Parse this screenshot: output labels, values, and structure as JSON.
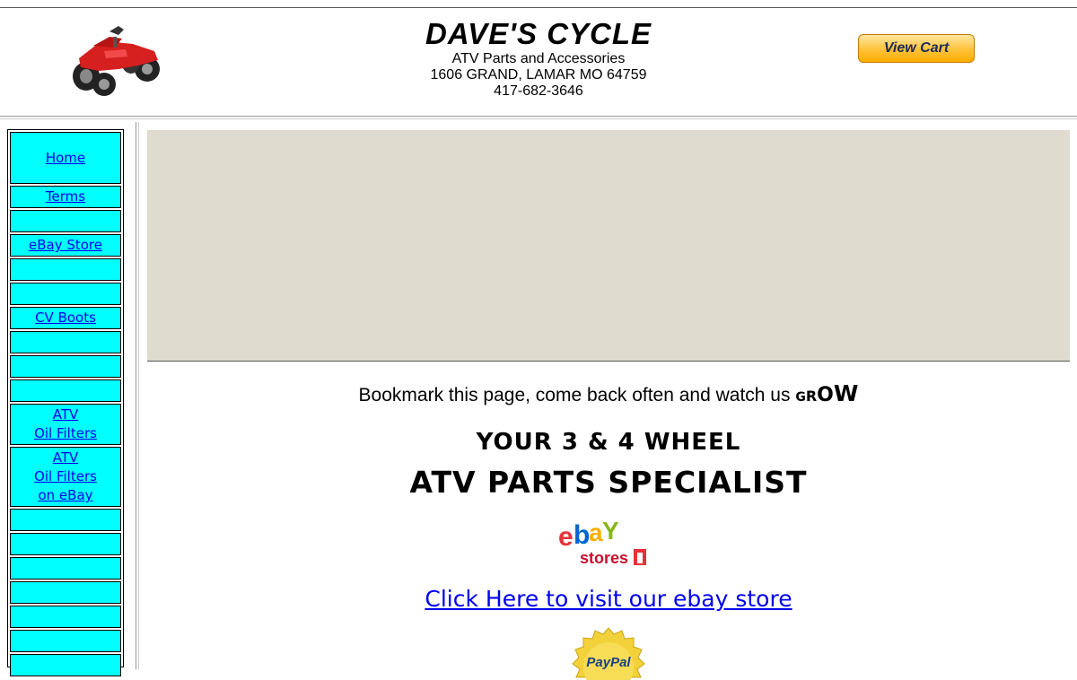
{
  "header": {
    "title": "DAVE'S CYCLE",
    "subtitle": "ATV Parts and Accessories",
    "address": "1606 GRAND, LAMAR MO 64759",
    "phone": "417-682-3646",
    "view_cart_label": "View Cart"
  },
  "sidebar": {
    "items": [
      {
        "lines": [
          "Home"
        ]
      },
      {
        "lines": [
          "Terms"
        ]
      },
      {
        "lines": []
      },
      {
        "lines": [
          "eBay Store"
        ]
      },
      {
        "lines": []
      },
      {
        "lines": []
      },
      {
        "lines": [
          "CV Boots"
        ]
      },
      {
        "lines": []
      },
      {
        "lines": []
      },
      {
        "lines": []
      },
      {
        "lines": [
          "ATV",
          "Oil Filters"
        ]
      },
      {
        "lines": [
          "ATV",
          "Oil Filters",
          "on eBay"
        ]
      },
      {
        "lines": []
      },
      {
        "lines": []
      },
      {
        "lines": []
      },
      {
        "lines": []
      },
      {
        "lines": []
      },
      {
        "lines": []
      },
      {
        "lines": []
      }
    ]
  },
  "main": {
    "bookmark_text": "Bookmark this page, come back often and watch us",
    "grow_letters": [
      "G",
      "R",
      "O",
      "W"
    ],
    "headline_1": "YOUR 3 & 4 WHEEL",
    "headline_2": "ATV PARTS SPECIALIST",
    "ebay_logo": {
      "letters": [
        "e",
        "b",
        "a",
        "Y"
      ],
      "stores_text": "stores"
    },
    "ebay_link_text": "Click Here to visit our ebay store",
    "paypal_seal_text": "PayPal"
  },
  "colors": {
    "nav_cell": "#00ffff",
    "banner": "#dfdbcf",
    "link": "#0000ee",
    "ebay_red": "#e53238",
    "ebay_blue": "#0064d2",
    "ebay_yellow": "#f5af02",
    "ebay_green": "#86b817"
  },
  "icons": {
    "header_logo": "red-quad-atv-icon",
    "cart": "view-cart-button",
    "ebay": "ebay-stores-logo",
    "paypal": "paypal-verified-seal"
  }
}
